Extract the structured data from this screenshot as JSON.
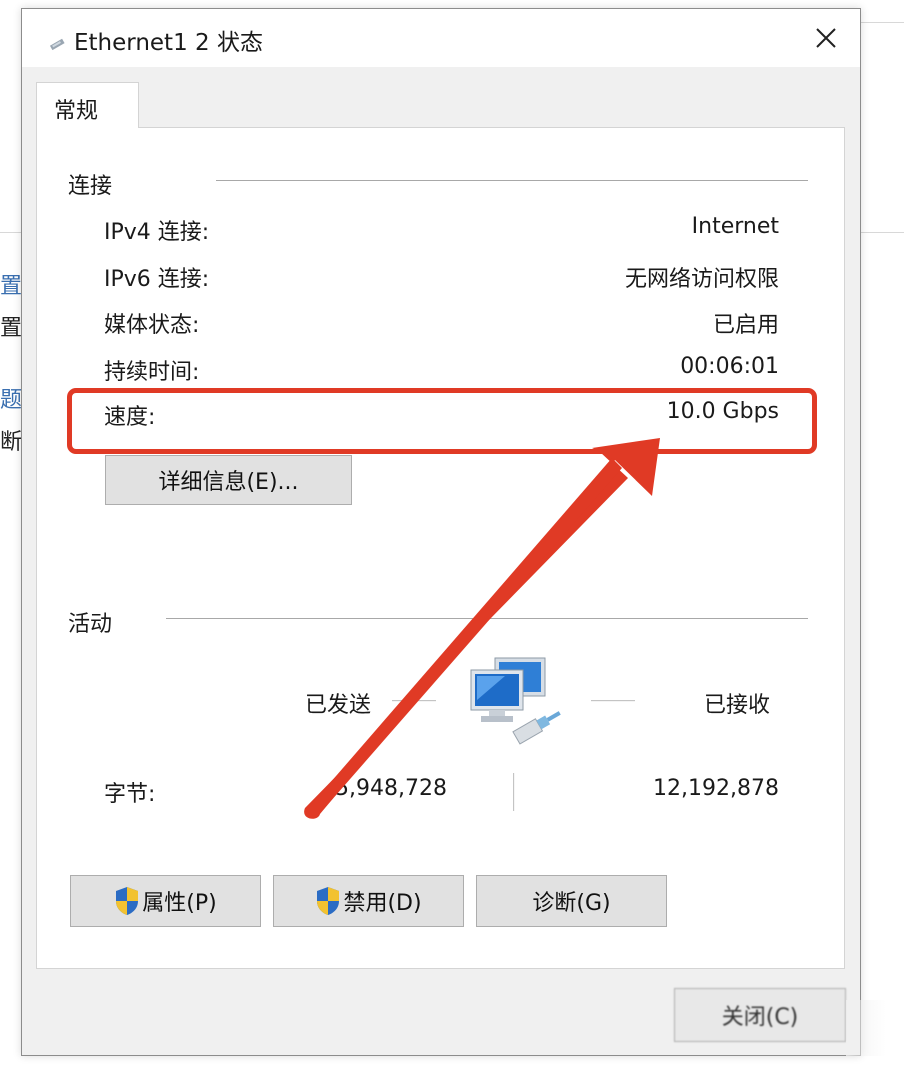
{
  "window": {
    "title": "Ethernet1 2 状态",
    "close_glyph": "✕"
  },
  "background_window": {
    "fragments": [
      "置新",
      "置宽",
      "题疑",
      "断并"
    ]
  },
  "tabs": [
    {
      "label": "常规",
      "selected": true
    }
  ],
  "connection": {
    "section_title": "连接",
    "rows": [
      {
        "label": "IPv4 连接:",
        "value": "Internet"
      },
      {
        "label": "IPv6 连接:",
        "value": "无网络访问权限"
      },
      {
        "label": "媒体状态:",
        "value": "已启用"
      },
      {
        "label": "持续时间:",
        "value": "00:06:01"
      },
      {
        "label": "速度:",
        "value": "10.0 Gbps"
      }
    ],
    "details_button": "详细信息(E)..."
  },
  "activity": {
    "section_title": "活动",
    "sent_label": "已发送",
    "received_label": "已接收",
    "bytes_label": "字节:",
    "bytes_sent": "5,948,728",
    "bytes_received": "12,192,878",
    "network_icon": "network-computers-icon"
  },
  "buttons": {
    "properties": "属性(P)",
    "disable": "禁用(D)",
    "diagnose": "诊断(G)",
    "close": "关闭(C)"
  },
  "annotation": {
    "highlight_color": "#e03a25",
    "arrow_color": "#e03a25"
  }
}
